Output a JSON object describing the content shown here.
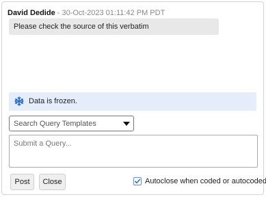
{
  "comment": {
    "author": "David Dedide",
    "separator": " - ",
    "timestamp": "30-Oct-2023 01:11:42 PM PDT",
    "text": "Please check the source of this verbatim"
  },
  "frozen_banner": {
    "icon": "snowflake-icon",
    "text": "Data is frozen.",
    "background": "#e4edf9",
    "icon_color": "#2d6fc2"
  },
  "query_template": {
    "placeholder": "Search Query Templates"
  },
  "query_input": {
    "placeholder": "Submit a Query...",
    "value": ""
  },
  "buttons": {
    "post": "Post",
    "close": "Close"
  },
  "autoclose": {
    "label": "Autoclose when coded or autocoded",
    "checked": true
  }
}
